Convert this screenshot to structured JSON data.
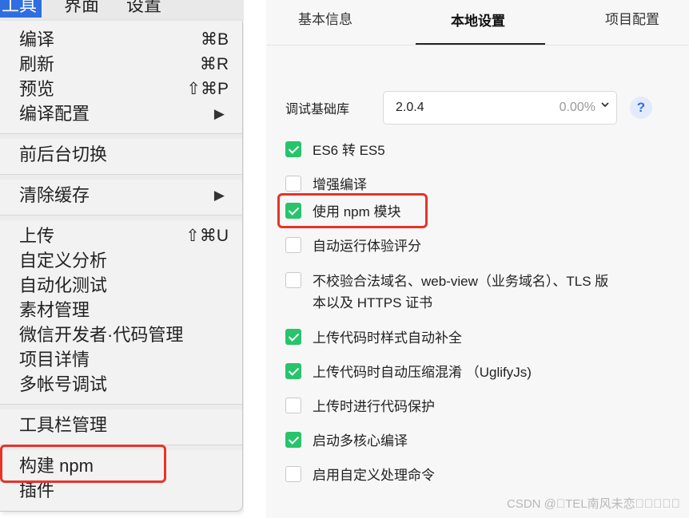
{
  "menubar": {
    "items": [
      "工具",
      "界面",
      "设置"
    ]
  },
  "menu": {
    "items": [
      {
        "label": "编译",
        "shortcut": "⌘B"
      },
      {
        "label": "刷新",
        "shortcut": "⌘R"
      },
      {
        "label": "预览",
        "shortcut": "⇧⌘P"
      },
      {
        "label": "编译配置",
        "arrow": "▶"
      },
      {
        "label": "前后台切换"
      },
      {
        "label": "清除缓存",
        "arrow": "▶"
      },
      {
        "label": "上传",
        "shortcut": "⇧⌘U"
      },
      {
        "label": "自定义分析"
      },
      {
        "label": "自动化测试"
      },
      {
        "label": "素材管理"
      },
      {
        "label": "微信开发者·代码管理"
      },
      {
        "label": "项目详情"
      },
      {
        "label": "多帐号调试"
      },
      {
        "label": "工具栏管理"
      },
      {
        "label": "构建 npm"
      },
      {
        "label": "插件"
      }
    ]
  },
  "settings": {
    "tabs": [
      "基本信息",
      "本地设置",
      "项目配置"
    ],
    "active_tab": "本地设置",
    "lib_label": "调试基础库",
    "lib_version": "2.0.4",
    "lib_percent": "0.00%",
    "help": "?",
    "options": [
      {
        "label": "ES6 转 ES5",
        "checked": true
      },
      {
        "label": "增强编译",
        "checked": false
      },
      {
        "label": "使用 npm 模块",
        "checked": true
      },
      {
        "label": "自动运行体验评分",
        "checked": false
      },
      {
        "label": "不校验合法域名、web-view（业务域名）、TLS 版",
        "label2": "本以及 HTTPS 证书",
        "checked": false
      },
      {
        "label": "上传代码时样式自动补全",
        "checked": true
      },
      {
        "label": "上传代码时自动压缩混淆 （UglifyJs)",
        "checked": true
      },
      {
        "label": "上传时进行代码保护",
        "checked": false
      },
      {
        "label": "启动多核心编译",
        "checked": true
      },
      {
        "label": "启用自定义处理命令",
        "checked": false
      }
    ]
  },
  "watermark": "CSDN @\u0000TEL南风未恋\u0000\u0000\u0000\u0000\u0000",
  "colors": {
    "accent": "#2e6ee0",
    "check": "#27c46b",
    "highlight": "#e8332a"
  }
}
